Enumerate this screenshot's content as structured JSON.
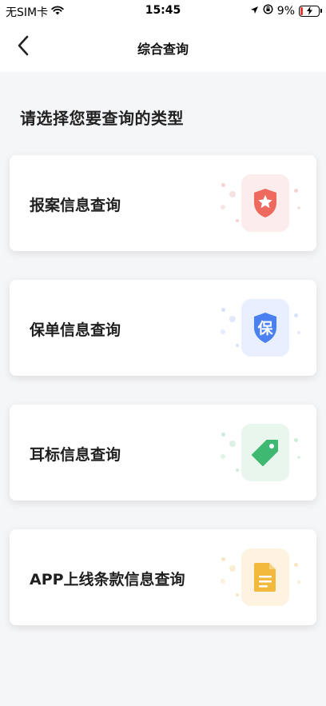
{
  "status": {
    "carrier": "无SIM卡",
    "time": "15:45",
    "battery": "9%"
  },
  "nav": {
    "title": "综合查询"
  },
  "section_title": "请选择您要查询的类型",
  "cards": [
    {
      "label": "报案信息查询",
      "icon": "shield-star-icon",
      "bg": "#fcecec",
      "color": "#ee6a5f"
    },
    {
      "label": "保单信息查询",
      "icon": "shield-bao-icon",
      "bg": "#e9efff",
      "color": "#4a80ef",
      "glyph": "保"
    },
    {
      "label": "耳标信息查询",
      "icon": "tag-icon",
      "bg": "#e8f6ee",
      "color": "#3fb871"
    },
    {
      "label": "APP上线条款信息查询",
      "icon": "document-icon",
      "bg": "#fdf3e0",
      "color": "#f3b93c"
    }
  ],
  "colors": {
    "background": "#f5f6f8",
    "card": "#ffffff"
  }
}
